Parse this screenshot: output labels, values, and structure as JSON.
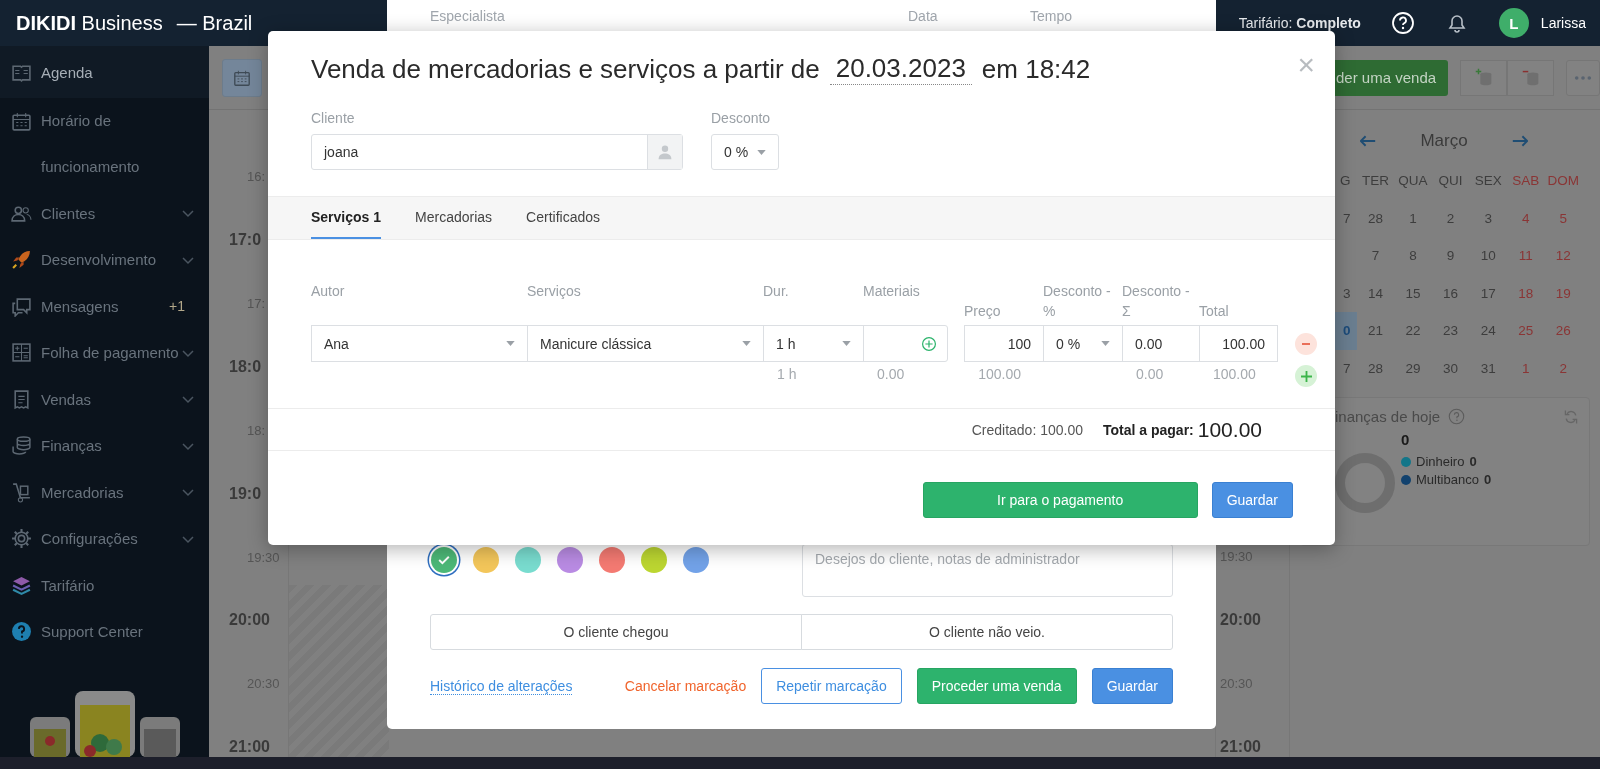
{
  "header": {
    "brand": "**DIKIDI** Business",
    "region": "— Brazil",
    "plan": "Tarifário: **Completo**",
    "avatar": "L",
    "user": "Larissa"
  },
  "sidebar": {
    "items": [
      {
        "label": "Agenda",
        "selected": true,
        "expandable": false
      },
      {
        "label": "Horário de funcionamento",
        "selected": false,
        "expandable": false
      },
      {
        "label": "Clientes",
        "selected": false,
        "expandable": true
      },
      {
        "label": "Desenvolvimento",
        "selected": false,
        "expandable": true
      },
      {
        "label": "Mensagens",
        "selected": false,
        "expandable": false,
        "badge": "+1"
      },
      {
        "label": "Folha de pagamento",
        "selected": false,
        "expandable": true
      },
      {
        "label": "Vendas",
        "selected": false,
        "expandable": true
      },
      {
        "label": "Finanças",
        "selected": false,
        "expandable": true
      },
      {
        "label": "Mercadorias",
        "selected": false,
        "expandable": true
      },
      {
        "label": "Configurações",
        "selected": false,
        "expandable": true
      },
      {
        "label": "Tarifário",
        "selected": false,
        "expandable": false
      },
      {
        "label": "Support Center",
        "selected": false,
        "expandable": false
      }
    ]
  },
  "schedule": {
    "times": [
      {
        "label": "16:",
        "major": false
      },
      {
        "label": "17:0",
        "major": true
      },
      {
        "label": "17:",
        "major": false
      },
      {
        "label": "18:0",
        "major": true
      },
      {
        "label": "18:",
        "major": false
      },
      {
        "label": "19:0",
        "major": true
      },
      {
        "label": "19:30",
        "major": false
      },
      {
        "label": "20:00",
        "major": true
      },
      {
        "label": "20:30",
        "major": false
      },
      {
        "label": "21:00",
        "major": true
      }
    ],
    "right_times": [
      {
        "label": "19:30",
        "major": false
      },
      {
        "label": "20:00",
        "major": true
      },
      {
        "label": "20:30",
        "major": false
      },
      {
        "label": "21:00",
        "major": true
      }
    ]
  },
  "right_panel": {
    "sale_button": "der uma venda",
    "month": "Março",
    "weekday_cut": "G",
    "weekdays": [
      {
        "label": "TER",
        "weekend": false
      },
      {
        "label": "QUA",
        "weekend": false
      },
      {
        "label": "QUI",
        "weekend": false
      },
      {
        "label": "SEX",
        "weekend": false
      },
      {
        "label": "SAB",
        "weekend": true
      },
      {
        "label": "DOM",
        "weekend": true
      }
    ],
    "weeks": [
      {
        "cut": "7",
        "selected": false,
        "days": [
          {
            "day": "28",
            "weekend": false
          },
          {
            "day": "1",
            "weekend": false
          },
          {
            "day": "2",
            "weekend": false
          },
          {
            "day": "3",
            "weekend": false
          },
          {
            "day": "4",
            "weekend": true
          },
          {
            "day": "5",
            "weekend": true
          }
        ]
      },
      {
        "selected": false,
        "days": [
          {
            "day": "7",
            "weekend": false
          },
          {
            "day": "8",
            "weekend": false
          },
          {
            "day": "9",
            "weekend": false
          },
          {
            "day": "10",
            "weekend": false
          },
          {
            "day": "11",
            "weekend": true
          },
          {
            "day": "12",
            "weekend": true
          }
        ]
      },
      {
        "cut": "3",
        "selected": false,
        "days": [
          {
            "day": "14",
            "weekend": false
          },
          {
            "day": "15",
            "weekend": false
          },
          {
            "day": "16",
            "weekend": false
          },
          {
            "day": "17",
            "weekend": false
          },
          {
            "day": "18",
            "weekend": true
          },
          {
            "day": "19",
            "weekend": true
          }
        ]
      },
      {
        "cut": "0",
        "selected": true,
        "days": [
          {
            "day": "21",
            "weekend": false
          },
          {
            "day": "22",
            "weekend": false
          },
          {
            "day": "23",
            "weekend": false
          },
          {
            "day": "24",
            "weekend": false
          },
          {
            "day": "25",
            "weekend": true
          },
          {
            "day": "26",
            "weekend": true
          }
        ]
      },
      {
        "cut": "7",
        "selected": false,
        "days": [
          {
            "day": "28",
            "weekend": false
          },
          {
            "day": "29",
            "weekend": false
          },
          {
            "day": "30",
            "weekend": false
          },
          {
            "day": "31",
            "weekend": false
          },
          {
            "day": "1",
            "weekend": true
          },
          {
            "day": "2",
            "weekend": true
          }
        ]
      }
    ],
    "finance": {
      "title": "inanças de hoje",
      "total": "0",
      "legend": [
        {
          "label": "Dinheiro",
          "value": "0",
          "color": "#137689"
        },
        {
          "label": "Multibanco",
          "value": "0",
          "color": "#12426e"
        }
      ]
    }
  },
  "appointment": {
    "columns": [
      "Especialista",
      "Data",
      "Tempo"
    ],
    "colors": [
      {
        "color": "#4cb877",
        "selected": true
      },
      {
        "color": "#f3c65a",
        "selected": false
      },
      {
        "color": "#79dccf",
        "selected": false
      },
      {
        "color": "#b98be3",
        "selected": false
      },
      {
        "color": "#f47a72",
        "selected": false
      },
      {
        "color": "#bcd631",
        "selected": false
      },
      {
        "color": "#72a2e8",
        "selected": false
      }
    ],
    "notes_placeholder": "Desejos do cliente, notas de administrador",
    "status_buttons": [
      "O cliente chegou",
      "O cliente não veio."
    ],
    "history": "Histórico de alterações",
    "cancel": "Cancelar marcação",
    "repeat": "Repetir marcação",
    "proceed": "Proceder uma venda",
    "save": "Guardar"
  },
  "sale": {
    "title": "Venda de mercadorias e serviços a partir de",
    "date": "20.03.2023",
    "time": "em 18:42",
    "close": "×",
    "client_label": "Cliente",
    "client": "joana",
    "discount_label": "Desconto",
    "discount": "0 %",
    "tabs": [
      {
        "label": "Serviços 1",
        "selected": true
      },
      {
        "label": "Mercadorias",
        "selected": false
      },
      {
        "label": "Certificados",
        "selected": false
      }
    ],
    "columns": [
      "Autor",
      "Serviços",
      "Dur.",
      "Materiais",
      "Preço",
      "Desconto - %",
      "Desconto - Σ",
      "Total"
    ],
    "row": [
      {
        "kind": "select",
        "value": "Ana"
      },
      {
        "kind": "select",
        "value": "Manicure clássica"
      },
      {
        "kind": "select",
        "value": "1 h"
      },
      {
        "kind": "add"
      },
      {
        "kind": "number",
        "value": "100"
      },
      {
        "kind": "select",
        "value": "0 %"
      },
      {
        "kind": "text",
        "value": "0.00"
      },
      {
        "kind": "number",
        "value": "100.00"
      }
    ],
    "totals": {
      "dur": "1 h",
      "materials": "0.00",
      "price": "100.00",
      "discount_sum": "0.00",
      "total": "100.00"
    },
    "credited": "Creditado: 100.00",
    "total_label": "Total a pagar:",
    "total": "100.00",
    "pay": "Ir para o pagamento",
    "save": "Guardar"
  }
}
